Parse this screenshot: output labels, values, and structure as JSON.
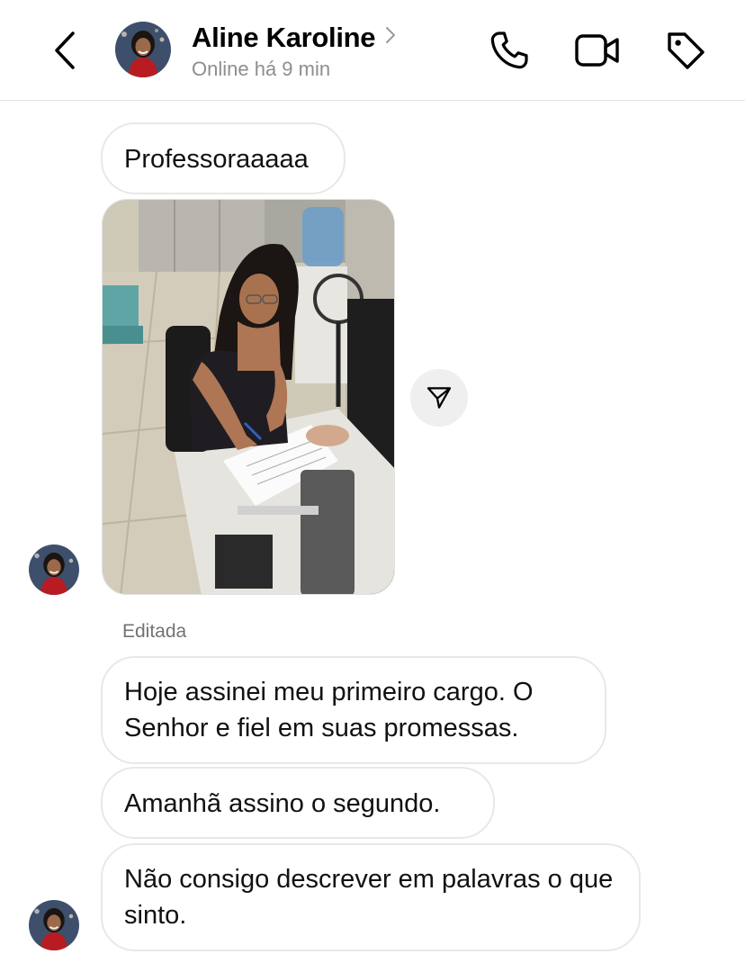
{
  "header": {
    "contact_name": "Aline Karoline",
    "status": "Online há 9 min"
  },
  "icons": {
    "back": "chevron-left-icon",
    "name_chevron": "chevron-right-icon",
    "phone": "phone-icon",
    "video": "video-camera-icon",
    "tag": "tag-icon",
    "share": "send-icon"
  },
  "messages": [
    {
      "type": "text",
      "text": "Professoraaaaa"
    },
    {
      "type": "image",
      "description": "photo"
    },
    {
      "type": "text",
      "edited_label": "Editada",
      "text": "Hoje assinei meu primeiro cargo. O Senhor e fiel em suas promessas."
    },
    {
      "type": "text",
      "text": "Amanhã assino o segundo."
    },
    {
      "type": "text",
      "text": "Não consigo descrever em palavras o que sinto."
    }
  ],
  "colors": {
    "bubble_border": "#e8e8e8",
    "muted_text": "#8e8e8e",
    "share_button_bg": "#efefef"
  }
}
